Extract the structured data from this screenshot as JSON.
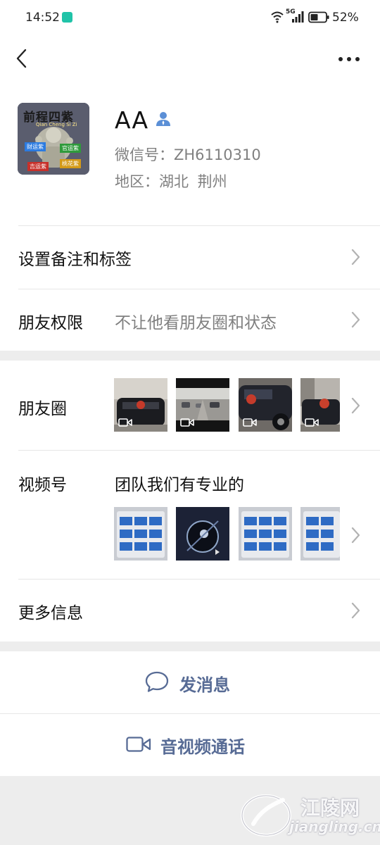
{
  "status_bar": {
    "time": "14:52",
    "network": "5G",
    "battery": "52%"
  },
  "profile": {
    "avatar_text": {
      "title": "前程四紫",
      "subtitle": "Qian Cheng Si Zi",
      "tags": [
        "财运紫",
        "官运紫",
        "吉运紫",
        "桃花紫"
      ]
    },
    "nickname": "AA",
    "wechat_id": "微信号：ZH6110310",
    "region": "地区：湖北  荆州"
  },
  "rows": {
    "remark_label": "设置备注和标签",
    "permission_label": "朋友权限",
    "permission_value": "不让他看朋友圈和状态",
    "moments_label": "朋友圈",
    "channels_label": "视频号",
    "channels_value": "团队我们有专业的",
    "more_label": "更多信息"
  },
  "actions": {
    "message": "发消息",
    "call": "音视频通话"
  },
  "watermark": {
    "name": "江陵网",
    "url": "jiangling.cn"
  },
  "colors": {
    "link": "#576b95",
    "background": "#ededed",
    "secondary_text": "#808080"
  },
  "icons": [
    "back-icon",
    "more-icon",
    "person-icon",
    "chevron-right-icon",
    "video-icon",
    "chat-bubble-icon",
    "video-camera-icon"
  ]
}
